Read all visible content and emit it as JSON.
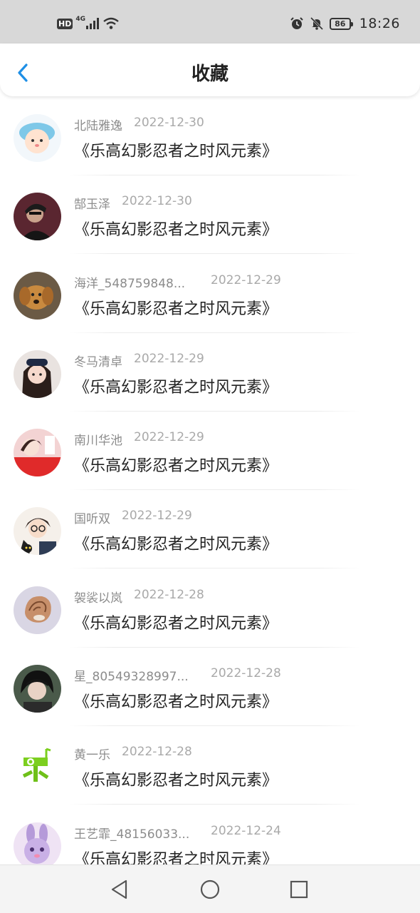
{
  "status_bar": {
    "hd": "HD",
    "network": "4G",
    "battery": "86",
    "time": "18:26",
    "icons": [
      "signal-icon",
      "wifi-icon",
      "alarm-icon",
      "mute-bell-icon",
      "battery-icon"
    ]
  },
  "header": {
    "title": "收藏",
    "accent": "#1e8fe6"
  },
  "favorites": [
    {
      "user": "北陆雅逸",
      "date": "2022-12-30",
      "title": "《乐高幻影忍者之时风元素》"
    },
    {
      "user": "郜玉泽",
      "date": "2022-12-30",
      "title": "《乐高幻影忍者之时风元素》"
    },
    {
      "user": "海洋_548759848...",
      "date": "2022-12-29",
      "title": "《乐高幻影忍者之时风元素》"
    },
    {
      "user": "冬马清卓",
      "date": "2022-12-29",
      "title": "《乐高幻影忍者之时风元素》"
    },
    {
      "user": "南川华池",
      "date": "2022-12-29",
      "title": "《乐高幻影忍者之时风元素》"
    },
    {
      "user": "国听双",
      "date": "2022-12-29",
      "title": "《乐高幻影忍者之时风元素》"
    },
    {
      "user": "袈裟以岚",
      "date": "2022-12-28",
      "title": "《乐高幻影忍者之时风元素》"
    },
    {
      "user": "星_80549328997...",
      "date": "2022-12-28",
      "title": "《乐高幻影忍者之时风元素》"
    },
    {
      "user": "黄一乐",
      "date": "2022-12-28",
      "title": "《乐高幻影忍者之时风元素》"
    },
    {
      "user": "王艺霏_48156033...",
      "date": "2022-12-24",
      "title": "《乐高幻影忍者之时风元素》"
    }
  ],
  "nav": {
    "icons": [
      "back-triangle-icon",
      "home-circle-icon",
      "recents-square-icon"
    ]
  }
}
